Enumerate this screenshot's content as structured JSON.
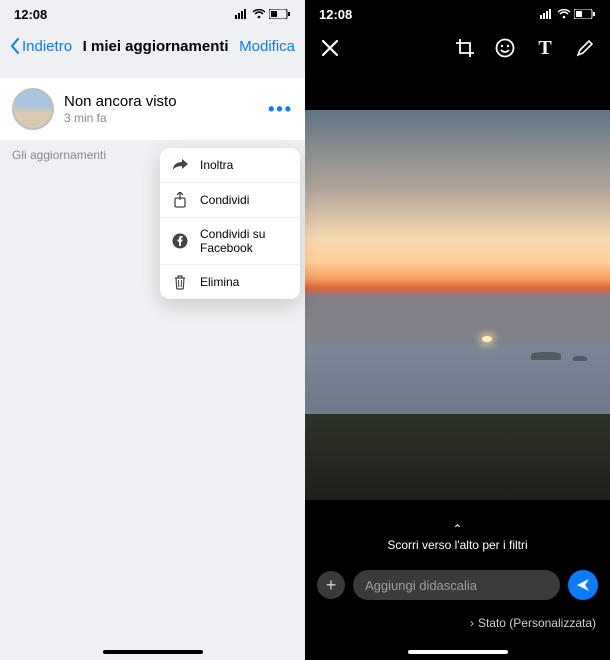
{
  "statusbar": {
    "time": "12:08"
  },
  "left": {
    "nav": {
      "back": "Indietro",
      "title": "I miei aggiornamenti",
      "edit": "Modifica"
    },
    "status": {
      "title": "Non ancora visto",
      "time": "3 min fa",
      "more": "•••"
    },
    "footer": "Gli aggiornamenti",
    "popover": {
      "forward": "Inoltra",
      "share": "Condividi",
      "share_fb": "Condividi su Facebook",
      "delete": "Elimina"
    }
  },
  "right": {
    "swipe_chevron": "⌃",
    "swipe_label": "Scorri verso l'alto per i filtri",
    "add_label": "+",
    "caption_placeholder": "Aggiungi didascalia",
    "privacy_chevron": "›",
    "privacy_label": "Stato (Personalizzata)",
    "text_tool": "T"
  }
}
